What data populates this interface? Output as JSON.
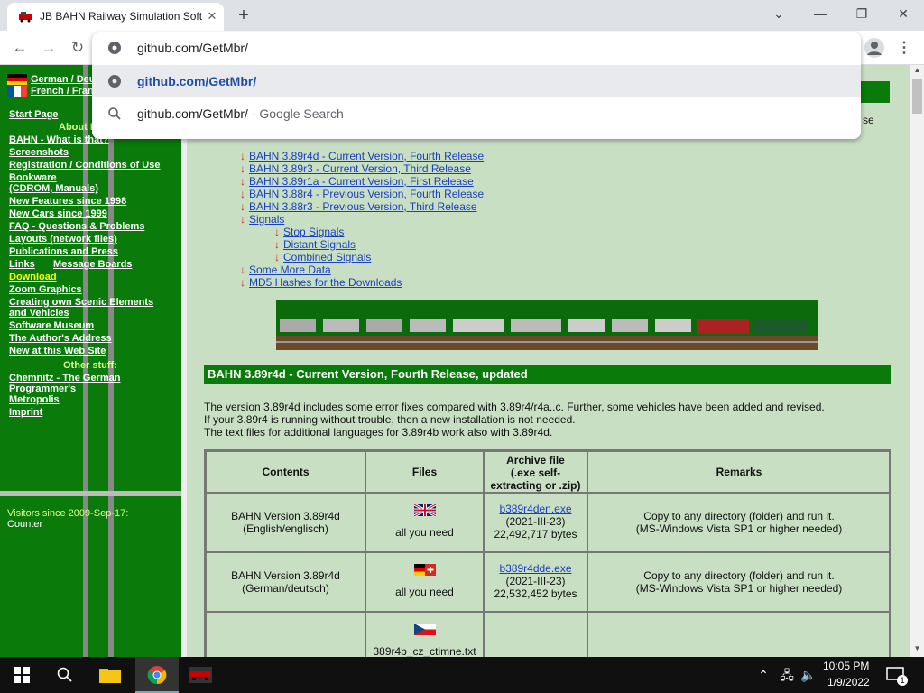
{
  "browser": {
    "tab_title": "JB BAHN Railway Simulation Software",
    "address": "github.com/GetMbr/",
    "suggestions": [
      {
        "text": "github.com/GetMbr/",
        "suffix": ""
      },
      {
        "text": "github.com/GetMbr/",
        "suffix": " - Google Search"
      }
    ],
    "window_controls": {
      "minimize": "—",
      "maximize": "❐",
      "close": "✕"
    },
    "tab_close": "✕",
    "new_tab": "+"
  },
  "sidebar": {
    "languages": [
      "German / Deutsch",
      "French / Français"
    ],
    "start_page": "Start Page",
    "about_heading": "About BAHN",
    "items": [
      "BAHN - What is that?",
      "Screenshots",
      "Registration / Conditions of Use",
      "Bookware",
      "(CDROM, Manuals)",
      "New Features since 1998",
      "New Cars since 1999",
      "FAQ - Questions & Problems",
      "Layouts (network files)",
      "Publications and Press",
      "Links",
      "Download",
      "Zoom Graphics",
      "Creating own Scenic Elements",
      "and Vehicles",
      "Software Museum",
      "The Author's Address",
      "New at this Web Site"
    ],
    "message_boards": "Message Boards",
    "other_heading": "Other stuff:",
    "other_items": [
      "Chemnitz - The German",
      "Programmer's",
      "Metropolis",
      "Imprint"
    ],
    "visitors": "Visitors since 2009-Sep-17:",
    "counter_alt": "Counter"
  },
  "content": {
    "partial_right_text": "se",
    "toc": [
      "BAHN 3.89r4d - Current Version, Fourth Release",
      "BAHN 3.89r3 - Current Version, Third Release",
      "BAHN 3.89r1a - Current Version, First Release",
      "BAHN 3.88r4 - Previous Version, Fourth Release",
      "BAHN 3.88r3 - Previous Version, Third Release",
      "Signals"
    ],
    "toc_sub": [
      "Stop Signals",
      "Distant Signals",
      "Combined Signals"
    ],
    "toc_tail": [
      "Some More Data",
      "MD5 Hashes for the Downloads"
    ],
    "section_title": "BAHN 3.89r4d - Current Version, Fourth Release, updated",
    "paragraphs": [
      "The version 3.89r4d includes some error fixes compared with 3.89r4/r4a..c. Further, some vehicles have been added and revised.",
      "If your 3.89r4 is running without trouble, then a new installation is not needed.",
      "The text files for additional languages for 3.89r4b work also with 3.89r4d."
    ],
    "table": {
      "headers": [
        "Contents",
        "Files",
        "Archive file (.exe self-extracting or .zip)",
        "Remarks"
      ],
      "header_archive_lines": [
        "Archive file",
        "(.exe self-",
        "extracting or .zip)"
      ],
      "rows": [
        {
          "contents": [
            "BAHN Version 3.89r4d",
            "(English/englisch)"
          ],
          "files": "all you need",
          "archive": "b389r4den.exe",
          "date": "(2021-III-23)",
          "size": "22,492,717 bytes",
          "remarks": [
            "Copy to any directory (folder) and run it.",
            "(MS-Windows Vista SP1 or higher needed)"
          ]
        },
        {
          "contents": [
            "BAHN Version 3.89r4d",
            "(German/deutsch)"
          ],
          "files": "all you need",
          "archive": "b389r4dde.exe",
          "date": "(2021-III-23)",
          "size": "22,532,452 bytes",
          "remarks": [
            "Copy to any directory (folder) and run it.",
            "(MS-Windows Vista SP1 or higher needed)"
          ]
        },
        {
          "contents": [
            "",
            ""
          ],
          "files": "389r4b_cz_ctimne.txt",
          "archive": "",
          "date": "",
          "size": "",
          "remarks": [
            "",
            ""
          ]
        }
      ]
    }
  },
  "taskbar": {
    "time": "10:05 PM",
    "date": "1/9/2022",
    "notification_count": "1"
  }
}
